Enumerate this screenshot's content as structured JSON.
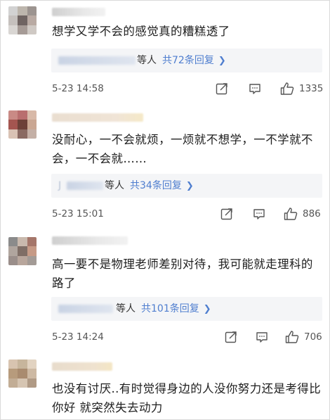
{
  "comments": [
    {
      "text": "想学又学不会的感觉真的糟糕透了",
      "reply_suffix": "等人",
      "reply_count": "共72条回复",
      "date": "5-23 14:58",
      "likes": "1335",
      "avatar_colors": [
        "#d2d2d2",
        "#bdb6ad",
        "#9c9490",
        "#c5c0bd",
        "#6f6462",
        "#b9aaa3",
        "#d9d6d3",
        "#a69b96",
        "#cfc9c4"
      ]
    },
    {
      "text": "没耐心，一不会就烦，一烦就不想学，一不学就不会，一不会就……",
      "reply_prefix": "J",
      "reply_suffix": "等人",
      "reply_count": "共34条回复",
      "date": "5-23 15:01",
      "likes": "886",
      "avatar_colors": [
        "#c98a85",
        "#b96e6e",
        "#d8b9a8",
        "#a45550",
        "#6d4038",
        "#caa793",
        "#d9c2b4",
        "#8a6a62",
        "#c4b0a6"
      ]
    },
    {
      "text": "高一要不是物理老师差别对待，我可能就走理科的路了",
      "reply_suffix": "等人",
      "reply_count": "共101条回复",
      "date": "5-23 14:24",
      "likes": "706",
      "avatar_colors": [
        "#8b8b8b",
        "#c9b9ad",
        "#a5766a",
        "#b0a59e",
        "#7f6e66",
        "#c69a86",
        "#9a8e8a",
        "#b8a69c",
        "#a39b96"
      ]
    },
    {
      "text": "也没有讨厌..有时觉得身边的人没你努力还是考得比你好 就突然失去动力",
      "avatar_colors": [
        "#d8c4b0",
        "#c7b59c",
        "#e2d3c1",
        "#b79b7c",
        "#a98b6f",
        "#cdb9a3",
        "#c2ad95",
        "#d6c5b2",
        "#b09a85"
      ]
    }
  ],
  "icons": {
    "share": "share-icon",
    "comment": "comment-icon",
    "like": "thumbs-up-icon",
    "chevron": "chevron-right-icon"
  },
  "colors": {
    "link": "#4f7ecf",
    "reply_bg": "#f4f5f7",
    "meta": "#555555"
  }
}
